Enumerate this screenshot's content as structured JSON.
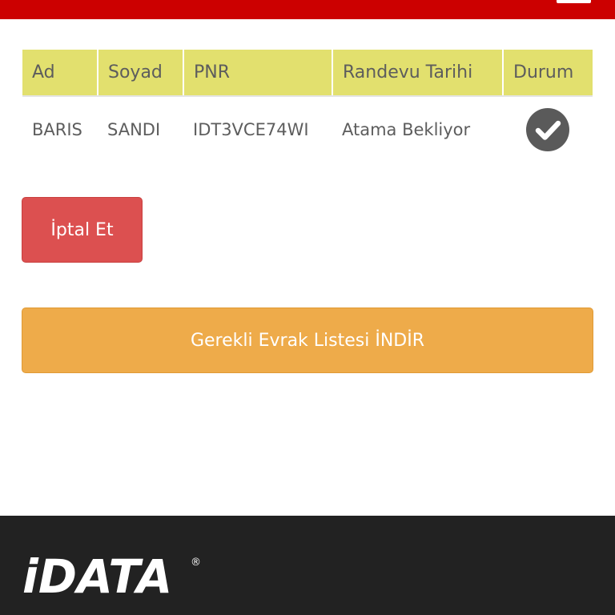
{
  "table": {
    "headers": {
      "ad": "Ad",
      "soyad": "Soyad",
      "pnr": "PNR",
      "tarih": "Randevu Tarihi",
      "durum": "Durum"
    },
    "rows": [
      {
        "ad": "BARIS",
        "soyad": "SANDI",
        "pnr": "IDT3VCE74WI",
        "tarih": "Atama Bekliyor",
        "durum_icon": "check-circle-icon"
      }
    ]
  },
  "actions": {
    "cancel_label": "İptal Et",
    "download_label": "Gerekli Evrak Listesi İNDİR"
  },
  "footer": {
    "logo_text": "iDATA",
    "logo_mark": "®"
  },
  "colors": {
    "top_bar": "#cc0000",
    "table_header": "#e2e06e",
    "cancel": "#dc5050",
    "download": "#eeab4a",
    "footer": "#222222",
    "text": "#5d5d5d"
  }
}
